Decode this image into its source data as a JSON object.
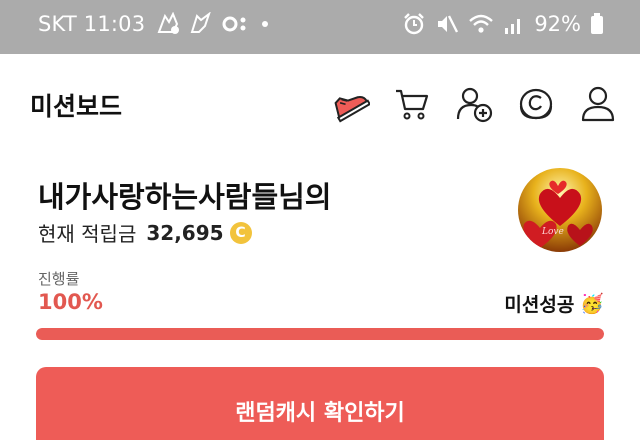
{
  "status_bar": {
    "carrier_time": "SKT 11:03",
    "battery": "92%"
  },
  "header": {
    "title": "미션보드",
    "icons": [
      "sneaker-icon",
      "cart-icon",
      "add-friend-icon",
      "coin-c-icon",
      "profile-icon"
    ]
  },
  "profile": {
    "nickname": "내가사랑하는사람들님의",
    "points_label": "현재 적립금",
    "points_value": "32,695",
    "coin_symbol": "C"
  },
  "progress": {
    "label": "진행률",
    "value_text": "100%",
    "value": 100,
    "status": "미션성공",
    "status_emoji": "🥳"
  },
  "cta": {
    "label": "랜덤캐시 확인하기"
  },
  "colors": {
    "accent": "#ee5c57",
    "progress_track": "#f3d6d4",
    "coin": "#f2c33c",
    "status_bar": "#ababab"
  }
}
